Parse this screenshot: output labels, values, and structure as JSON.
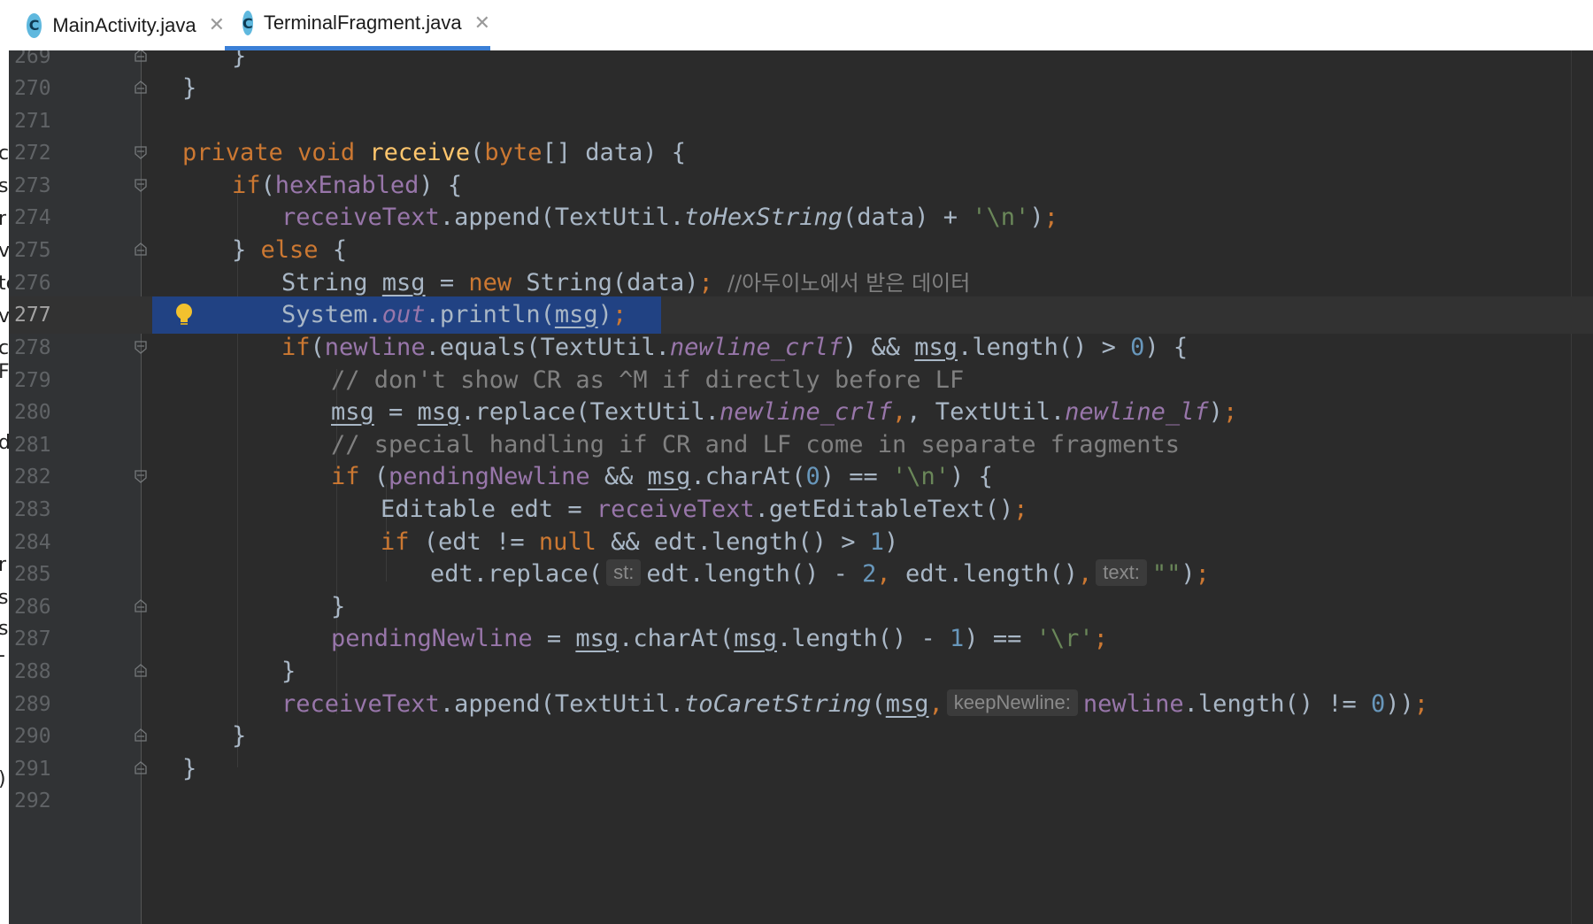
{
  "tabs": [
    {
      "label": "MainActivity.java",
      "icon": "class-icon",
      "icon_letter": "C",
      "active": false
    },
    {
      "label": "TerminalFragment.java",
      "icon": "class-icon",
      "icon_letter": "C",
      "active": true
    }
  ],
  "left_panel_fragments": [
    "c",
    "s",
    "r",
    "v",
    "te",
    "v",
    "cl",
    "F",
    "d",
    "r",
    "s",
    "s",
    "-",
    ")"
  ],
  "editor": {
    "current_line": "277",
    "lines": [
      {
        "n": "269"
      },
      {
        "n": "270"
      },
      {
        "n": "271"
      },
      {
        "n": "272"
      },
      {
        "n": "273"
      },
      {
        "n": "274"
      },
      {
        "n": "275"
      },
      {
        "n": "276"
      },
      {
        "n": "277"
      },
      {
        "n": "278"
      },
      {
        "n": "279"
      },
      {
        "n": "280"
      },
      {
        "n": "281"
      },
      {
        "n": "282"
      },
      {
        "n": "283"
      },
      {
        "n": "284"
      },
      {
        "n": "285"
      },
      {
        "n": "286"
      },
      {
        "n": "287"
      },
      {
        "n": "288"
      },
      {
        "n": "289"
      },
      {
        "n": "290"
      },
      {
        "n": "291"
      },
      {
        "n": "292"
      }
    ],
    "tokens": {
      "close_brace": "}",
      "open_brace": "{",
      "private": "private",
      "void": "void",
      "receive": "receive",
      "byte": "byte",
      "arr_data": "[] data) {",
      "if": "if",
      "if_sp": "if ",
      "hexEnabled": "hexEnabled",
      "receiveText": "receiveText",
      "append": ".append(TextUtil.",
      "toHexString": "toHexString",
      "data_plus": "(data) + ",
      "nl_char": "'\\n'",
      "cr_char": "'\\r'",
      "semi": ";",
      "else": "else",
      "String": "String ",
      "msg": "msg",
      "eq": " = ",
      "new": "new",
      "string_data": " String(data)",
      "comment_ko": "//아두이노에서 받은 데이터",
      "system": "System.",
      "out": "out",
      "println": ".println(",
      "close_semi": ");",
      "newline": "newline",
      "equals": ".equals(TextUtil.",
      "newline_crlf": "newline_crlf",
      "newline_lf": "newline_lf",
      "and_msg": ") && ",
      "length_gt": ".length() > ",
      "zero": "0",
      "one": "1",
      "two": "2",
      "close_brace_open": ") {",
      "comment1": "// don't show CR as ^M if directly before LF",
      "replace": ".replace(TextUtil.",
      "comma_tu": ", TextUtil.",
      "comment2": "// special handling if CR and LF come in separate fragments",
      "open_paren": "(",
      "pendingNewline": "pendingNewline",
      "and": " && ",
      "charAt": ".charAt(",
      "eqeq": ") == ",
      "close_paren_brace": ") {",
      "editable": "Editable edt = ",
      "getEditable": ".getEditableText()",
      "edt_ne": "(edt != ",
      "null": "null",
      "edt_len_gt": " && edt.length() > ",
      "close_paren": ")",
      "edt_replace": "edt.replace(",
      "hint_st": "st:",
      "edt_len_minus": "edt.length() - ",
      "comma": ", ",
      "edt_len_comma": "edt.length()",
      "hint_text": "text:",
      "empty_str": "\"\"",
      "pending_eq": " = ",
      "charAt2": ".charAt(",
      "len_minus": ".length() - ",
      "eqeq2": ") == ",
      "toCaretString": "toCaretString",
      "hint_keep": "keepNewline:",
      "len_ne": ".length() != ",
      "close2": "))",
      "close_paren_simple": ")"
    }
  },
  "colors": {
    "keyword": "#cc7832",
    "method_decl": "#ffc66d",
    "field": "#9876aa",
    "string": "#6a8759",
    "number": "#6897bb",
    "comment": "#808080",
    "selection": "#214283",
    "tab_underline": "#3b7fd6"
  }
}
